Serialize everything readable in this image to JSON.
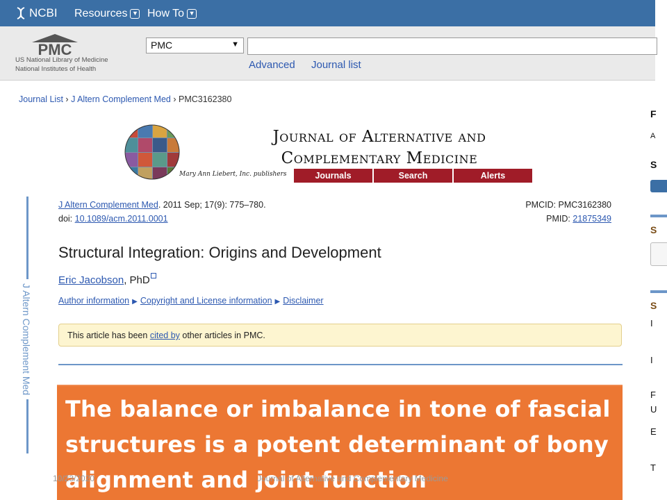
{
  "ncbi_bar": {
    "logo_text": "NCBI",
    "resources": "Resources",
    "howto": "How To"
  },
  "pmc_header": {
    "logo": "PMC",
    "sub1": "US National Library of Medicine",
    "sub2": "National Institutes of Health",
    "db_select_value": "PMC",
    "search_value": "",
    "advanced": "Advanced",
    "journal_list": "Journal list"
  },
  "breadcrumb": {
    "journal_list": "Journal List",
    "journal": "J Altern Complement Med",
    "current": "PMC3162380"
  },
  "journal_banner": {
    "title_line1": "Journal of Alternative and",
    "title_line2": "Complementary Medicine",
    "publisher": "Mary Ann Liebert, Inc. publishers",
    "nav": [
      "Journals",
      "Search",
      "Alerts"
    ]
  },
  "side_label": "J Altern Complement Med",
  "citation": {
    "journal": "J Altern Complement Med",
    "details": ". 2011 Sep; 17(9): 775–780.",
    "doi_label": "doi: ",
    "doi": "10.1089/acm.2011.0001",
    "pmcid": "PMCID: PMC3162380",
    "pmid_label": "PMID: ",
    "pmid": "21875349"
  },
  "article": {
    "title": "Structural Integration: Origins and Development",
    "author": "Eric Jacobson",
    "credentials": ", PhD",
    "links": [
      "Author information",
      "Copyright and License information",
      "Disclaimer"
    ],
    "cited_prefix": "This article has been ",
    "cited_link": "cited by",
    "cited_suffix": " other articles in PMC."
  },
  "sidebar": {
    "items": [
      "F",
      "A",
      "S",
      "S",
      "S",
      "I",
      "I",
      "F",
      "U",
      "E",
      "T"
    ]
  },
  "overlay_text": "The balance or imbalance in tone of fascial structures is a potent determinant of bony alignment and joint function",
  "footer": {
    "date": "10/23/2020",
    "source": "Journal of Alternative and Complementary Medicine"
  },
  "colors": {
    "ncbi_blue": "#3b6fa5",
    "link_blue": "#2c58b0",
    "journal_red": "#a01c28",
    "overlay_orange": "#ec7733"
  }
}
